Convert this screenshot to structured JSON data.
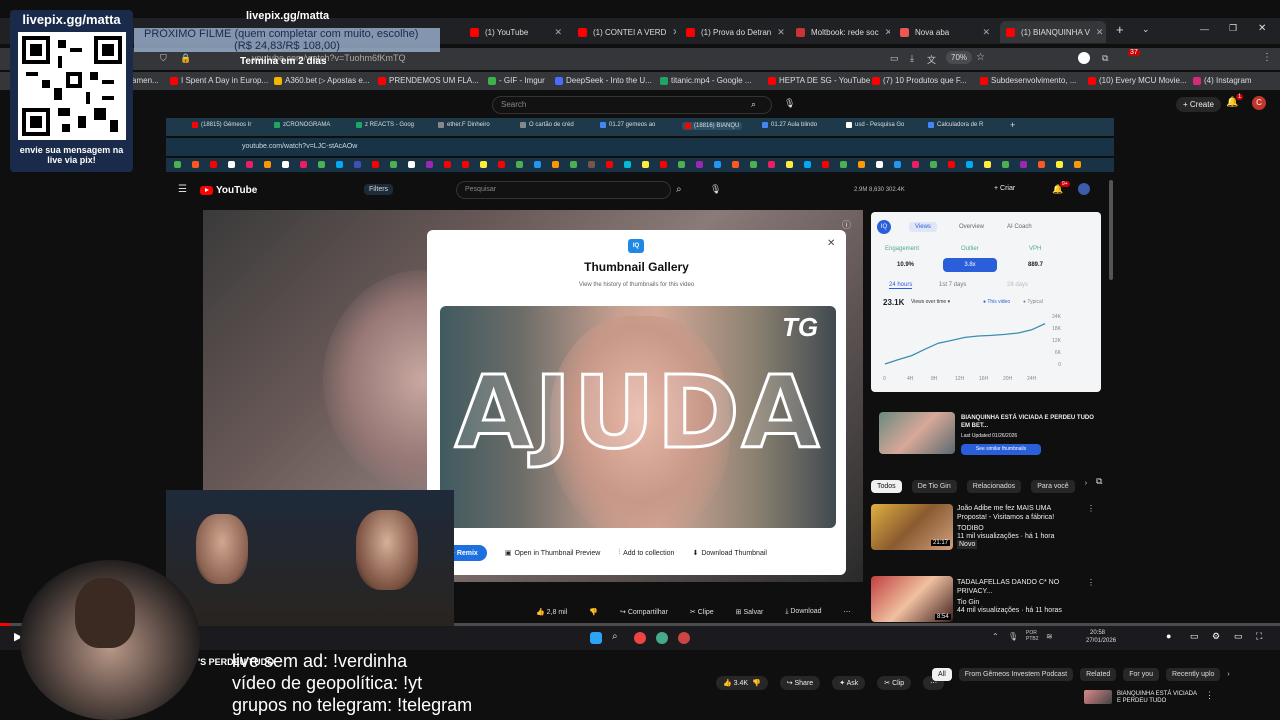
{
  "outer_tabs": [
    {
      "label": "(1) YouTube",
      "color": "#ff0000"
    },
    {
      "label": "(1) CONTEI A VERD",
      "color": "#ff0000"
    },
    {
      "label": "(1) Prova do Detran",
      "color": "#ff0000"
    },
    {
      "label": "Moltbook: rede soc",
      "color": "#c33"
    },
    {
      "label": "Nova aba",
      "color": "#e55"
    },
    {
      "label": "(1) BIANQUINHA V",
      "color": "#ff0000"
    }
  ],
  "outer_address": {
    "url": "youtube.com/watch?v=Tuohm6fKmTQ",
    "zoom": "70%"
  },
  "outer_bookmarks": [
    "amen...",
    "I Spent A Day in Europ...",
    "A360.bet ▷ Apostas e...",
    "PRENDEMOS UM FLA...",
    "- GIF - Imgur",
    "DeepSeek - Into the U...",
    "titanic.mp4 - Google ...",
    "HEPTA DE SG - YouTube",
    "(7) 10 Produtos que F...",
    "Subdesenvolvimento, ...",
    "(10) Every MCU Movie...",
    "(4) Instagram"
  ],
  "outer_yt": {
    "search_placeholder": "Search",
    "create_label": "Create",
    "notif_count": "1"
  },
  "overlay": {
    "livepix_title": "livepix.gg/matta",
    "livepix_sub": "envie sua mensagem na live via pix!",
    "livepix_top": "livepix.gg/matta",
    "next_film_line1": "PRÓXIMO FILME (quem completar com muito, escolhe)",
    "next_film_line2": "(R$ 24,83/R$ 108,00)",
    "termina": "Termina em 2 dias",
    "commands": [
      "live sem ad: !verdinha",
      "vídeo de geopolítica: !yt",
      "grupos no telegram: !telegram"
    ],
    "perdeu": "'S PERDEU TUDO"
  },
  "inner_tabs": [
    "(18815) Gêmeos Ir",
    "zCRONOGRAMA",
    "z REACTS - Goog",
    "ether.F Dinheiro",
    "O cartão de créd",
    "01.27 gemeos ao",
    "(18816) BIANQU",
    "01.27 Aula blindo",
    "usd - Pesquisa Go",
    "Calculadora de R"
  ],
  "inner_address": "youtube.com/watch?v=LJC-stAcAOw",
  "inner_yt": {
    "filters": "Filters",
    "search_placeholder": "Pesquisar",
    "stats": "2.9M  8,630  302.4K",
    "create": "Criar",
    "notif": "9+"
  },
  "modal": {
    "logo": "IQ",
    "title": "Thumbnail Gallery",
    "subtitle": "View the history of thumbnails for this video",
    "thumb_text": "AJUDA",
    "thumb_badge": "TG",
    "actions": [
      "Remix",
      "Open in Thumbnail Preview",
      "Add to collection",
      "Download Thumbnail"
    ]
  },
  "video_actions": [
    "2,8 mil",
    "Compartilhar",
    "Clipe",
    "Salvar",
    "Download"
  ],
  "right_panel": {
    "tabs": [
      "Views",
      "Overview",
      "AI Coach"
    ],
    "stats_labels": [
      "Engagement",
      "Outlier",
      "VPH"
    ],
    "stats_values": [
      "10.9%",
      "3.8x",
      "889.7"
    ],
    "time_tabs": [
      "24 hours",
      "1st 7 days",
      "28 days"
    ],
    "views": "23.1K",
    "views_dropdown": "Views over time",
    "legend": [
      "This video",
      "Typical"
    ],
    "y_ticks": [
      "24K",
      "18K",
      "12K",
      "6K",
      "0"
    ],
    "x_ticks": [
      "0",
      "4H",
      "8H",
      "12H",
      "16H",
      "20H",
      "24H"
    ],
    "chart_values": [
      0,
      2200,
      4200,
      7400,
      10400,
      11800,
      13300,
      14000,
      14300,
      14800,
      15500,
      17100,
      20200
    ],
    "video_title": "BIANQUINHA ESTÁ VICIADA E PERDEU TUDO EM BET...",
    "video_updated": "Last Updated 01/26/2026",
    "similar_btn": "See similar thumbnails"
  },
  "chips": [
    "Todos",
    "De Tio Gin",
    "Relacionados",
    "Para você"
  ],
  "recs": [
    {
      "title": "João Adibe me fez MAIS UMA Proposta! - Visitamos a fábrica!",
      "channel": "TODIBO",
      "meta": "11 mil visualizações · há 1 hora",
      "badge": "Novo",
      "duration": "21:17"
    },
    {
      "title": "TADALAFELLAS DANDO C* NO PRIVACY...",
      "channel": "Tio Gin",
      "meta": "44 mil visualizações · há 11 horas",
      "duration": "8:54"
    }
  ],
  "taskbar": {
    "lang": "POR PTB2",
    "time": "20:58",
    "date": "27/01/2026"
  },
  "outer_bottom": {
    "likes": "3.4K",
    "share": "Share",
    "ask": "Ask",
    "clip": "Clip"
  },
  "outer_chips": [
    "All",
    "From Gêmeos Investem Podcast",
    "Related",
    "For you",
    "Recently uplo"
  ],
  "outer_rec_title": "BIANQUINHA ESTÁ VICIADA E PERDEU TUDO"
}
